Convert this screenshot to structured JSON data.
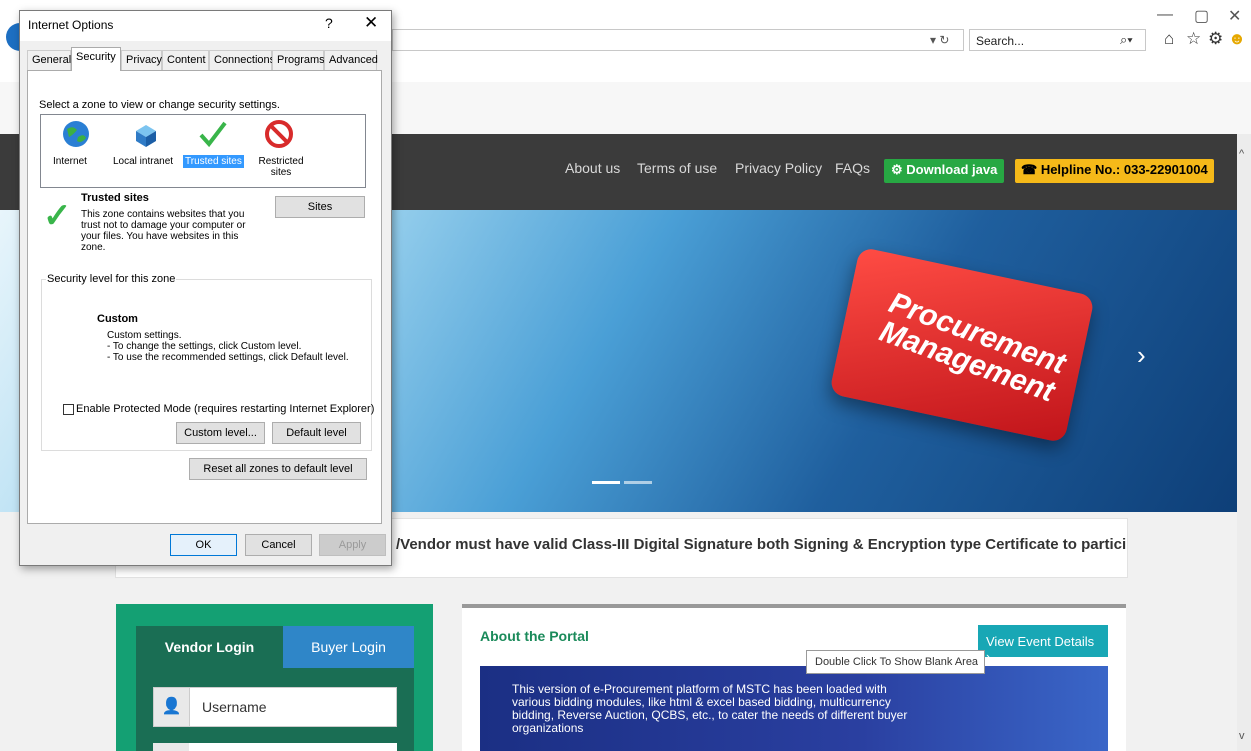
{
  "browser": {
    "search_placeholder": "Search...",
    "addr_controls": "▾ ↻",
    "window": {
      "minimize": "—",
      "restore": "▢",
      "close": "✕"
    },
    "toolbar_icons": [
      "home-icon",
      "favorites-star-icon",
      "tools-gear-icon",
      "smiley-feedback-icon"
    ]
  },
  "site": {
    "nav": [
      "About us",
      "Terms of use",
      "Privacy Policy",
      "FAQs"
    ],
    "download_java": "Download java",
    "helpline": "Helpline No.: 033-22901004",
    "banner_text": "Procurement Management",
    "notice": "/Vendor must have valid Class-III Digital Signature both Signing & Encryption type Certificate to participat",
    "login_tabs": [
      "Vendor Login",
      "Buyer Login"
    ],
    "username_placeholder": "Username",
    "about_title": "About the Portal",
    "view_event_button": "View Event Details ›",
    "tooltip": "Double Click To Show Blank Area",
    "about_text": "This version of e-Procurement platform of MSTC has been loaded with various bidding modules, like html & excel based bidding, multicurrency bidding, Reverse Auction, QCBS, etc., to cater the needs of different buyer organizations",
    "colors": {
      "header": "#3b3b3b",
      "download": "#27a843",
      "helpline": "#f5b919",
      "login_green": "#14a073",
      "buyer_tab": "#2f86c8",
      "view_button": "#18a7b5"
    }
  },
  "dialog": {
    "title": "Internet Options",
    "help": "?",
    "close": "✕",
    "tabs": [
      "General",
      "Security",
      "Privacy",
      "Content",
      "Connections",
      "Programs",
      "Advanced"
    ],
    "active_tab": "Security",
    "zone_prompt": "Select a zone to view or change security settings.",
    "zones": [
      {
        "label": "Internet",
        "icon": "globe-icon"
      },
      {
        "label": "Local intranet",
        "icon": "intranet-icon"
      },
      {
        "label": "Trusted sites",
        "icon": "checkmark-icon",
        "selected": true
      },
      {
        "label": "Restricted sites",
        "icon": "no-entry-icon"
      }
    ],
    "zone_name": "Trusted sites",
    "zone_desc": "This zone contains websites that you trust not to damage your computer or your files. You have websites in this zone.",
    "sites_button": "Sites",
    "security_level_label": "Security level for this zone",
    "custom_title": "Custom",
    "custom_desc": "Custom settings.\n- To change the settings, click Custom level.\n- To use the recommended settings, click Default level.",
    "protected_mode": "Enable Protected Mode (requires restarting Internet Explorer)",
    "protected_mode_checked": false,
    "custom_level_button": "Custom level...",
    "default_level_button": "Default level",
    "reset_button": "Reset all zones to default level",
    "ok": "OK",
    "cancel": "Cancel",
    "apply": "Apply"
  }
}
